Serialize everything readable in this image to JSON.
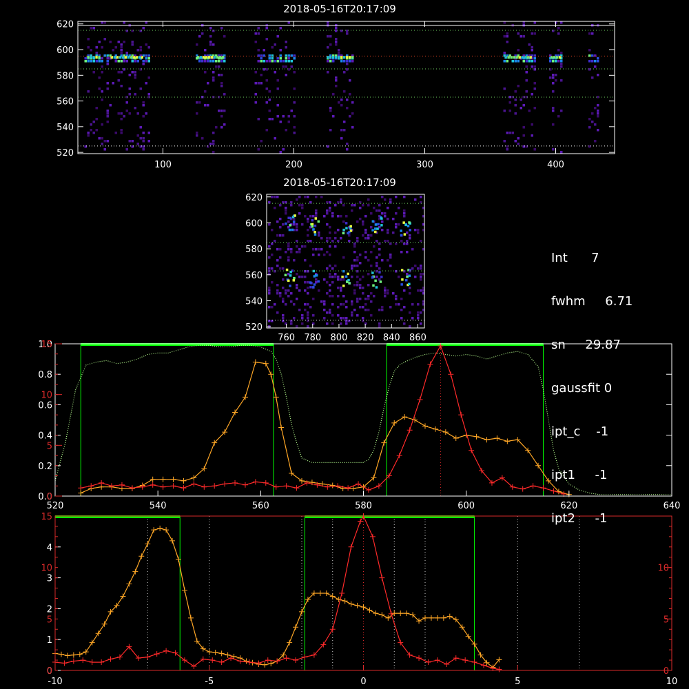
{
  "panel_top": {
    "title": "2018-05-16T20:17:09",
    "xticks": [
      "100",
      "200",
      "300",
      "400"
    ],
    "yticks": [
      "520",
      "540",
      "560",
      "580",
      "600",
      "620"
    ]
  },
  "panel_mid": {
    "title": "2018-05-16T20:17:09",
    "xticks": [
      "760",
      "780",
      "800",
      "820",
      "840",
      "860"
    ],
    "yticks": [
      "520",
      "540",
      "560",
      "580",
      "600",
      "620"
    ]
  },
  "info": [
    {
      "label": "Int",
      "value": "7"
    },
    {
      "label": "fwhm",
      "value": "6.71"
    },
    {
      "label": "sn",
      "value": "29.87"
    },
    {
      "label": "gaussfit",
      "value": "0"
    },
    {
      "label": "ipt_c",
      "value": "-1"
    },
    {
      "label": "ipt1",
      "value": "-1"
    },
    {
      "label": "ipt2",
      "value": "-1"
    }
  ],
  "colors": {
    "background": "#000000",
    "axes": "#ffffff",
    "series_a": "#ffa726",
    "series_b": "#ff2a2a",
    "box": "#00ff00",
    "transmission": "#b8ff90"
  },
  "chart_data": [
    {
      "type": "heatmap",
      "title": "2018-05-16T20:17:09",
      "xlim": [
        35,
        445
      ],
      "ylim": [
        519,
        622
      ],
      "xticks": [
        100,
        200,
        300,
        400
      ],
      "yticks": [
        520,
        540,
        560,
        580,
        600,
        620
      ],
      "hlines": [
        615,
        595,
        585,
        563,
        525
      ],
      "bands": [
        [
          40,
          90
        ],
        [
          125,
          148
        ],
        [
          170,
          200
        ],
        [
          225,
          245
        ],
        [
          360,
          385
        ],
        [
          395,
          405
        ],
        [
          425,
          432
        ]
      ]
    },
    {
      "type": "heatmap",
      "title": "2018-05-16T20:17:09",
      "xlim": [
        745,
        865
      ],
      "ylim": [
        519,
        622
      ],
      "xticks": [
        760,
        780,
        800,
        820,
        840,
        860
      ],
      "yticks": [
        520,
        540,
        560,
        580,
        600,
        620
      ],
      "hlines": [
        615,
        585,
        563,
        525
      ]
    },
    {
      "type": "line",
      "xlim": [
        520,
        640
      ],
      "xticks": [
        520,
        540,
        560,
        580,
        600,
        620,
        640
      ],
      "yticks_left_white": [
        0.0,
        0.2,
        0.4,
        0.6,
        0.8,
        1.0
      ],
      "yticks_left_red": [
        0,
        5,
        10,
        15
      ],
      "boxes": [
        [
          525,
          562.5
        ],
        [
          584.5,
          615
        ]
      ],
      "peak_line_x": 595,
      "series": [
        {
          "name": "",
          "color": "#ffa726",
          "x": [
            525,
            527,
            529,
            531,
            533,
            535,
            537,
            539,
            541,
            543,
            545,
            547,
            549,
            551,
            553,
            555,
            557,
            559,
            561,
            562,
            563,
            564,
            566,
            568,
            570,
            572,
            574,
            576,
            578,
            580,
            582,
            584,
            586,
            588,
            590,
            592,
            594,
            596,
            598,
            600,
            602,
            604,
            606,
            608,
            610,
            612,
            614,
            616,
            618,
            620
          ],
          "y": [
            0.02,
            0.05,
            0.06,
            0.06,
            0.05,
            0.05,
            0.07,
            0.11,
            0.11,
            0.11,
            0.1,
            0.12,
            0.18,
            0.35,
            0.42,
            0.55,
            0.65,
            0.88,
            0.87,
            0.8,
            0.65,
            0.45,
            0.15,
            0.1,
            0.09,
            0.08,
            0.07,
            0.05,
            0.05,
            0.06,
            0.12,
            0.35,
            0.48,
            0.52,
            0.5,
            0.46,
            0.44,
            0.42,
            0.38,
            0.4,
            0.39,
            0.37,
            0.38,
            0.36,
            0.37,
            0.3,
            0.2,
            0.1,
            0.03,
            0.01
          ]
        },
        {
          "name": "",
          "color": "#ff2a2a",
          "x": [
            525,
            527,
            529,
            531,
            533,
            535,
            537,
            539,
            541,
            543,
            545,
            547,
            549,
            551,
            553,
            555,
            557,
            559,
            561,
            563,
            565,
            567,
            569,
            571,
            573,
            575,
            577,
            579,
            581,
            583,
            585,
            587,
            589,
            591,
            593,
            595,
            597,
            599,
            601,
            603,
            605,
            607,
            609,
            611,
            613,
            615,
            617,
            619
          ],
          "y": [
            0.8,
            1.0,
            1.3,
            1.0,
            1.1,
            0.8,
            0.9,
            1.1,
            0.9,
            1.0,
            0.8,
            1.2,
            0.9,
            1.0,
            1.2,
            1.3,
            1.1,
            1.4,
            1.3,
            0.9,
            1.0,
            0.8,
            1.3,
            1.1,
            0.9,
            1.0,
            0.8,
            1.2,
            0.6,
            1.0,
            2.0,
            4.0,
            6.5,
            9.5,
            13.0,
            14.8,
            12.0,
            8.0,
            4.5,
            2.5,
            1.3,
            1.8,
            0.9,
            0.7,
            1.0,
            0.8,
            0.5,
            0.2
          ]
        },
        {
          "name": "",
          "color": "#b8ff90",
          "dotted": true,
          "x": [
            520,
            522,
            524,
            526,
            528,
            530,
            532,
            534,
            536,
            538,
            540,
            542,
            544,
            546,
            548,
            550,
            552,
            554,
            556,
            558,
            560,
            562,
            563,
            564,
            565,
            566,
            567,
            568,
            570,
            572,
            574,
            576,
            578,
            580,
            581,
            582,
            583,
            584,
            585,
            586,
            587,
            588,
            590,
            592,
            594,
            596,
            598,
            600,
            602,
            604,
            606,
            608,
            610,
            612,
            614,
            615,
            616,
            617,
            618,
            620,
            622,
            624,
            626,
            628,
            630,
            632,
            634,
            636,
            638,
            640
          ],
          "y": [
            0.1,
            0.35,
            0.7,
            0.86,
            0.88,
            0.89,
            0.87,
            0.88,
            0.9,
            0.93,
            0.94,
            0.94,
            0.96,
            0.98,
            0.99,
            0.99,
            0.98,
            0.98,
            0.99,
            0.99,
            0.98,
            0.95,
            0.9,
            0.8,
            0.65,
            0.47,
            0.35,
            0.25,
            0.22,
            0.22,
            0.22,
            0.22,
            0.22,
            0.22,
            0.24,
            0.3,
            0.42,
            0.58,
            0.72,
            0.82,
            0.86,
            0.88,
            0.91,
            0.93,
            0.94,
            0.93,
            0.92,
            0.93,
            0.92,
            0.9,
            0.92,
            0.94,
            0.95,
            0.93,
            0.85,
            0.7,
            0.5,
            0.3,
            0.18,
            0.08,
            0.04,
            0.02,
            0.01,
            0.01,
            0.01,
            0.01,
            0.01,
            0.01,
            0.01,
            0.01
          ]
        }
      ]
    },
    {
      "type": "line",
      "xlim": [
        -10,
        10
      ],
      "xticks": [
        -10,
        -5,
        0,
        5,
        10
      ],
      "yticks_left_white": [
        0,
        1,
        2,
        3,
        4
      ],
      "yticks_left_red": [
        0,
        5,
        10,
        15
      ],
      "yticks_right_red": [
        0,
        5,
        10
      ],
      "boxes": [
        [
          -10,
          -5.95
        ],
        [
          -1.9,
          3.6
        ]
      ],
      "vlines": [
        -7,
        -5,
        -2,
        -1,
        1,
        2,
        5,
        7
      ],
      "peak_line_x": 0,
      "series": [
        {
          "name": "",
          "color": "#ffa726",
          "x": [
            -10,
            -9.8,
            -9.6,
            -9.4,
            -9.2,
            -9.0,
            -8.8,
            -8.6,
            -8.4,
            -8.2,
            -8.0,
            -7.8,
            -7.6,
            -7.4,
            -7.2,
            -7.0,
            -6.8,
            -6.6,
            -6.4,
            -6.2,
            -6.0,
            -5.8,
            -5.6,
            -5.4,
            -5.2,
            -5.0,
            -4.8,
            -4.6,
            -4.4,
            -4.2,
            -4.0,
            -3.8,
            -3.6,
            -3.4,
            -3.2,
            -3.0,
            -2.8,
            -2.6,
            -2.4,
            -2.2,
            -2.0,
            -1.8,
            -1.6,
            -1.4,
            -1.2,
            -1.0,
            -0.8,
            -0.6,
            -0.4,
            -0.2,
            0.0,
            0.2,
            0.4,
            0.6,
            0.8,
            1.0,
            1.2,
            1.4,
            1.6,
            1.8,
            2.0,
            2.2,
            2.4,
            2.6,
            2.8,
            3.0,
            3.2,
            3.4,
            3.6,
            3.8,
            4.0,
            4.2,
            4.4
          ],
          "y": [
            0.55,
            0.52,
            0.48,
            0.5,
            0.52,
            0.6,
            0.9,
            1.2,
            1.5,
            1.9,
            2.1,
            2.4,
            2.8,
            3.2,
            3.7,
            4.1,
            4.55,
            4.6,
            4.55,
            4.2,
            3.6,
            2.6,
            1.7,
            0.95,
            0.7,
            0.6,
            0.58,
            0.55,
            0.5,
            0.45,
            0.4,
            0.3,
            0.25,
            0.2,
            0.18,
            0.22,
            0.3,
            0.5,
            0.9,
            1.4,
            1.9,
            2.3,
            2.5,
            2.5,
            2.5,
            2.4,
            2.3,
            2.25,
            2.15,
            2.1,
            2.05,
            1.95,
            1.85,
            1.8,
            1.7,
            1.85,
            1.85,
            1.85,
            1.8,
            1.6,
            1.7,
            1.7,
            1.7,
            1.7,
            1.75,
            1.65,
            1.4,
            1.1,
            0.85,
            0.5,
            0.25,
            0.1,
            0.35
          ]
        },
        {
          "name": "",
          "color": "#ff2a2a",
          "x": [
            -10,
            -9.7,
            -9.4,
            -9.1,
            -8.8,
            -8.5,
            -8.2,
            -7.9,
            -7.6,
            -7.3,
            -7.0,
            -6.7,
            -6.4,
            -6.1,
            -5.8,
            -5.5,
            -5.2,
            -4.9,
            -4.6,
            -4.3,
            -4.0,
            -3.7,
            -3.4,
            -3.1,
            -2.8,
            -2.5,
            -2.2,
            -1.9,
            -1.6,
            -1.3,
            -1.0,
            -0.7,
            -0.4,
            -0.1,
            0.0,
            0.3,
            0.6,
            0.9,
            1.2,
            1.5,
            1.8,
            2.1,
            2.4,
            2.7,
            3.0,
            3.3,
            3.6,
            3.9,
            4.2,
            4.4
          ],
          "y": [
            0.8,
            0.7,
            0.9,
            1.0,
            0.8,
            0.8,
            1.1,
            1.3,
            2.3,
            1.2,
            1.3,
            1.6,
            1.9,
            1.7,
            1.0,
            0.4,
            1.1,
            1.0,
            0.8,
            1.2,
            0.9,
            0.8,
            0.7,
            1.0,
            0.9,
            1.2,
            1.0,
            1.3,
            1.5,
            2.5,
            4.0,
            7.5,
            12.0,
            14.5,
            15.0,
            13.0,
            9.0,
            5.5,
            2.7,
            1.5,
            1.2,
            0.8,
            1.0,
            0.6,
            1.2,
            1.0,
            0.8,
            0.5,
            0.2,
            0.1
          ]
        }
      ]
    }
  ]
}
